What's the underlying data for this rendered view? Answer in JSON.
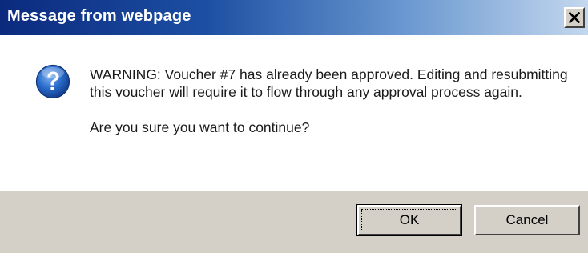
{
  "dialog": {
    "title": "Message from webpage",
    "close_symbol": "X",
    "icon": "question-icon",
    "message_line1": "WARNING:  Voucher #7 has already been approved.  Editing and resubmitting this voucher will require it to flow through any approval process again.",
    "message_line2": "Are you sure you want to continue?",
    "ok_label": "OK",
    "cancel_label": "Cancel"
  },
  "colors": {
    "titlebar_start": "#0b2a7e",
    "titlebar_end": "#c4d7ee",
    "footer": "#d4d0c8",
    "icon_blue": "#1f5fbf"
  }
}
